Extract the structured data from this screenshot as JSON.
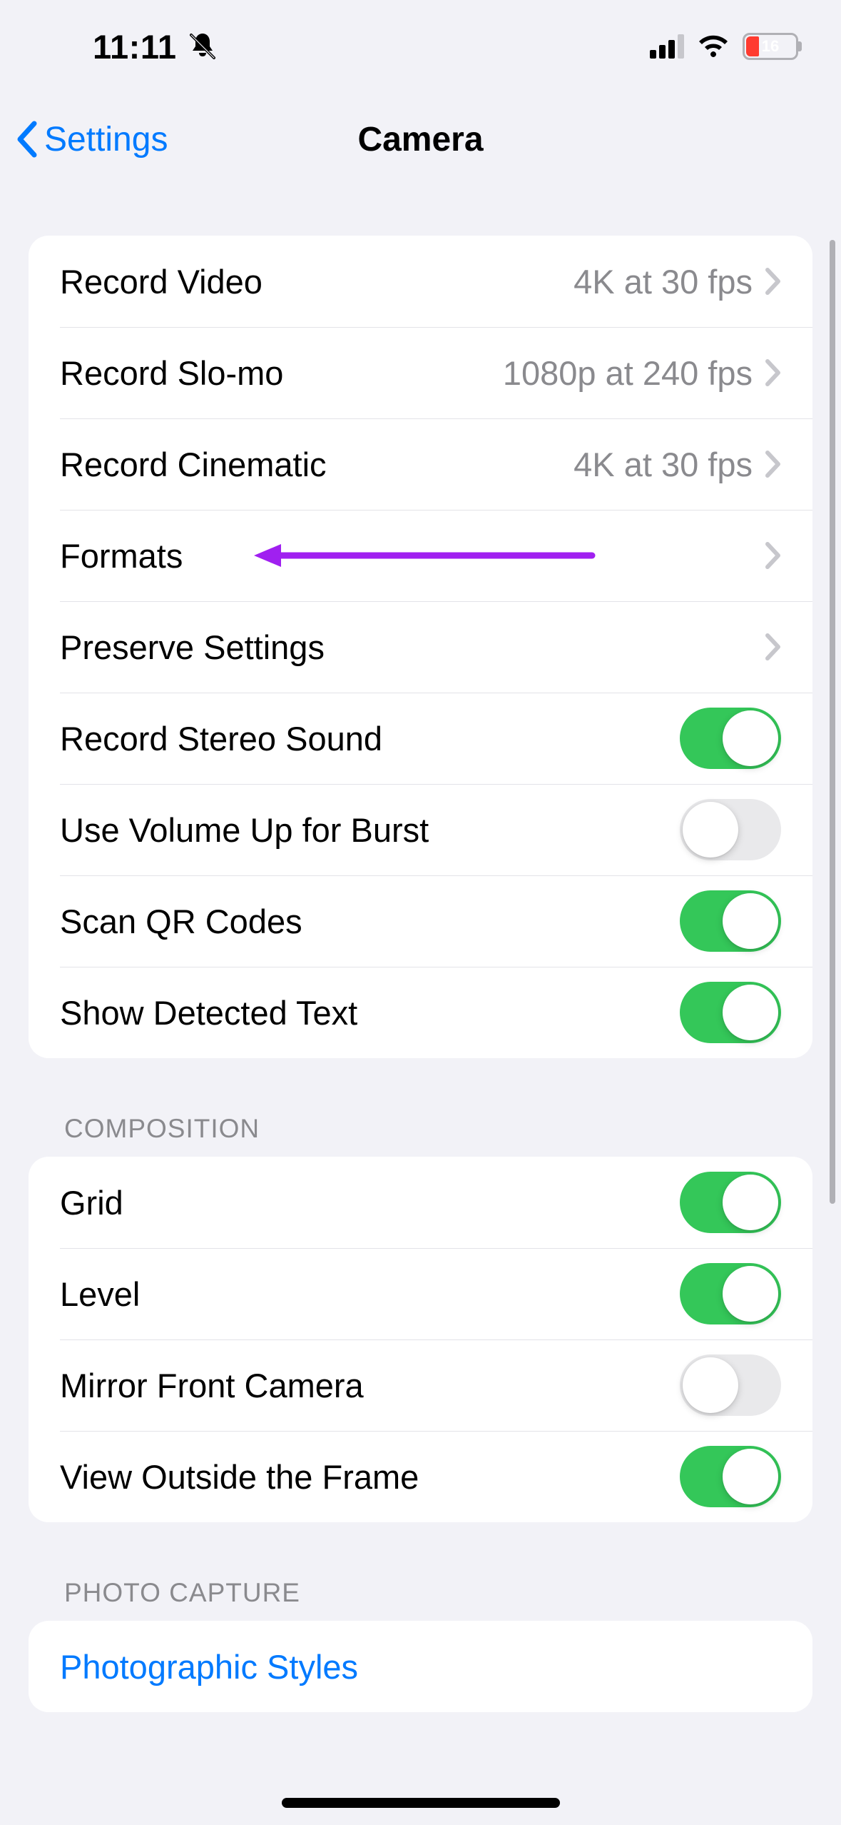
{
  "status": {
    "time": "11:11",
    "battery_pct": "16",
    "dnd": true
  },
  "nav": {
    "back_label": "Settings",
    "title": "Camera"
  },
  "groups": {
    "main": {
      "items": [
        {
          "label": "Record Video",
          "detail": "4K at 30 fps"
        },
        {
          "label": "Record Slo-mo",
          "detail": "1080p at 240 fps"
        },
        {
          "label": "Record Cinematic",
          "detail": "4K at 30 fps"
        },
        {
          "label": "Formats",
          "detail": ""
        },
        {
          "label": "Preserve Settings",
          "detail": ""
        },
        {
          "label": "Record Stereo Sound",
          "toggle": true
        },
        {
          "label": "Use Volume Up for Burst",
          "toggle": false
        },
        {
          "label": "Scan QR Codes",
          "toggle": true
        },
        {
          "label": "Show Detected Text",
          "toggle": true
        }
      ]
    },
    "composition": {
      "header": "Composition",
      "items": [
        {
          "label": "Grid",
          "toggle": true
        },
        {
          "label": "Level",
          "toggle": true
        },
        {
          "label": "Mirror Front Camera",
          "toggle": false
        },
        {
          "label": "View Outside the Frame",
          "toggle": true
        }
      ]
    },
    "photo_capture": {
      "header": "Photo Capture",
      "items": [
        {
          "label": "Photographic Styles"
        }
      ]
    }
  }
}
